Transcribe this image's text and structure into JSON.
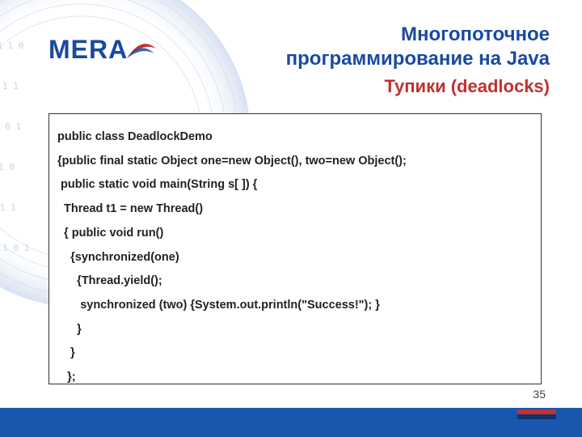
{
  "logo": {
    "text": "MERA"
  },
  "title": {
    "line1": "Многопоточное",
    "line2": "программирование на Java",
    "sub": "Тупики (deadlocks)"
  },
  "code": {
    "l0": "public class DeadlockDemo",
    "l1": "{public final static Object one=new Object(), two=new Object();",
    "l2": " public static void main(String s[ ]) {",
    "l3": "  Thread t1 = new Thread()",
    "l4": "  { public void run()",
    "l5": "    {synchronized(one)",
    "l6": "      {Thread.yield();",
    "l7": "       synchronized (two) {System.out.println(\"Success!\"); }",
    "l8": "      }",
    "l9": "    }",
    "l10": "   };"
  },
  "page_number": "35"
}
